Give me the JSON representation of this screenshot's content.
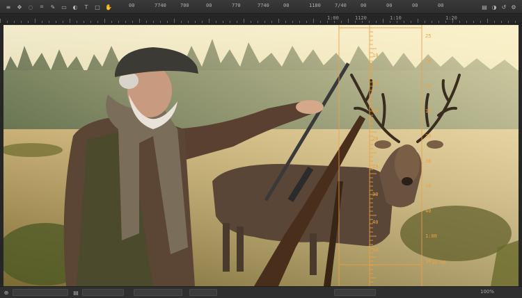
{
  "toolbar": {
    "icons_left": [
      "menu-icon",
      "move-icon",
      "lasso-icon",
      "crop-icon",
      "brush-icon",
      "eraser-icon",
      "gradient-icon",
      "text-icon",
      "shape-icon",
      "hand-icon"
    ],
    "numbers": [
      "00",
      "7740",
      "700",
      "00",
      "770",
      "7740",
      "00",
      "1180",
      "7/40",
      "00",
      "00",
      "00",
      "00"
    ],
    "icons_right": [
      "layers-icon",
      "adjust-icon",
      "history-icon",
      "settings-icon",
      "close-icon"
    ]
  },
  "ruler_top": {
    "labels": [
      "1:00",
      "1120",
      "1:10",
      "1:20"
    ]
  },
  "overlay": {
    "top_label": "1120",
    "right_labels": [
      "25",
      "19",
      "20",
      "10",
      "30",
      "30",
      "30",
      "40",
      "1:00",
      "10"
    ],
    "left_labels": [
      "10",
      "30",
      "20",
      "20",
      "20",
      "30",
      "40",
      "30"
    ],
    "bottom_label": "10.00",
    "accent_color": "#f0a040"
  },
  "statusbar": {
    "fields": [
      "",
      "",
      "",
      "",
      ""
    ],
    "text": "100%"
  }
}
